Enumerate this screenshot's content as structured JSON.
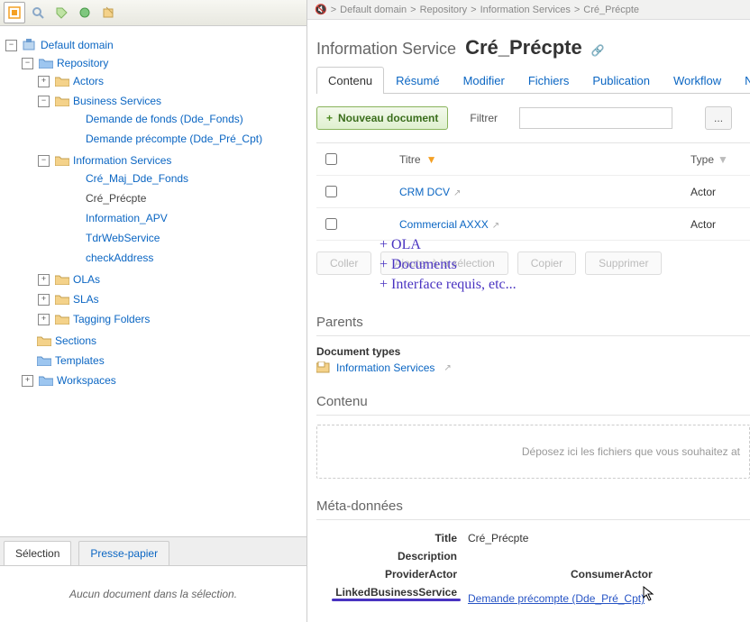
{
  "breadcrumb": [
    "Default domain",
    "Repository",
    "Information Services",
    "Cré_Précpte"
  ],
  "header": {
    "kind": "Information Service",
    "title": "Cré_Précpte"
  },
  "tabs": [
    "Contenu",
    "Résumé",
    "Modifier",
    "Fichiers",
    "Publication",
    "Workflow",
    "Notifications"
  ],
  "new_doc_btn": "Nouveau document",
  "filter_label": "Filtrer",
  "more_btn": "...",
  "columns": {
    "title": "Titre",
    "type": "Type"
  },
  "rows": [
    {
      "title": "CRM DCV",
      "type": "Actor"
    },
    {
      "title": "Commercial AXXX",
      "type": "Actor"
    }
  ],
  "actions": {
    "coller": "Coller",
    "ajouter": "Ajouter à la sélection",
    "copier": "Copier",
    "supprimer": "Supprimer"
  },
  "overlay": {
    "l1": "+ OLA",
    "l2": "+ Documents",
    "l3": "+ Interface requis, etc..."
  },
  "parents_h": "Parents",
  "doctypes_label": "Document types",
  "doctypes_link": "Information Services",
  "contenu_h": "Contenu",
  "dropzone": "Déposez ici les fichiers que vous souhaitez at",
  "meta_h": "Méta-données",
  "meta": {
    "title_k": "Title",
    "title_v": "Cré_Précpte",
    "desc_k": "Description",
    "desc_v": "",
    "provider_k": "ProviderActor",
    "consumer_k": "ConsumerActor",
    "linked_k": "LinkedBusinessService",
    "linked_v": "Demande précompte (Dde_Pré_Cpt)"
  },
  "sel_tabs": {
    "a": "Sélection",
    "b": "Presse-papier"
  },
  "sel_empty": "Aucun document dans la sélection.",
  "tree": {
    "root": "Default domain",
    "repo": "Repository",
    "actors": "Actors",
    "bs": "Business Services",
    "bs_children": [
      "Demande de fonds (Dde_Fonds)",
      "Demande précompte (Dde_Pré_Cpt)"
    ],
    "is": "Information Services",
    "is_children": [
      "Cré_Maj_Dde_Fonds",
      "Cré_Précpte",
      "Information_APV",
      "TdrWebService",
      "checkAddress"
    ],
    "olas": "OLAs",
    "slas": "SLAs",
    "tagging": "Tagging Folders",
    "sections": "Sections",
    "templates": "Templates",
    "workspaces": "Workspaces"
  }
}
